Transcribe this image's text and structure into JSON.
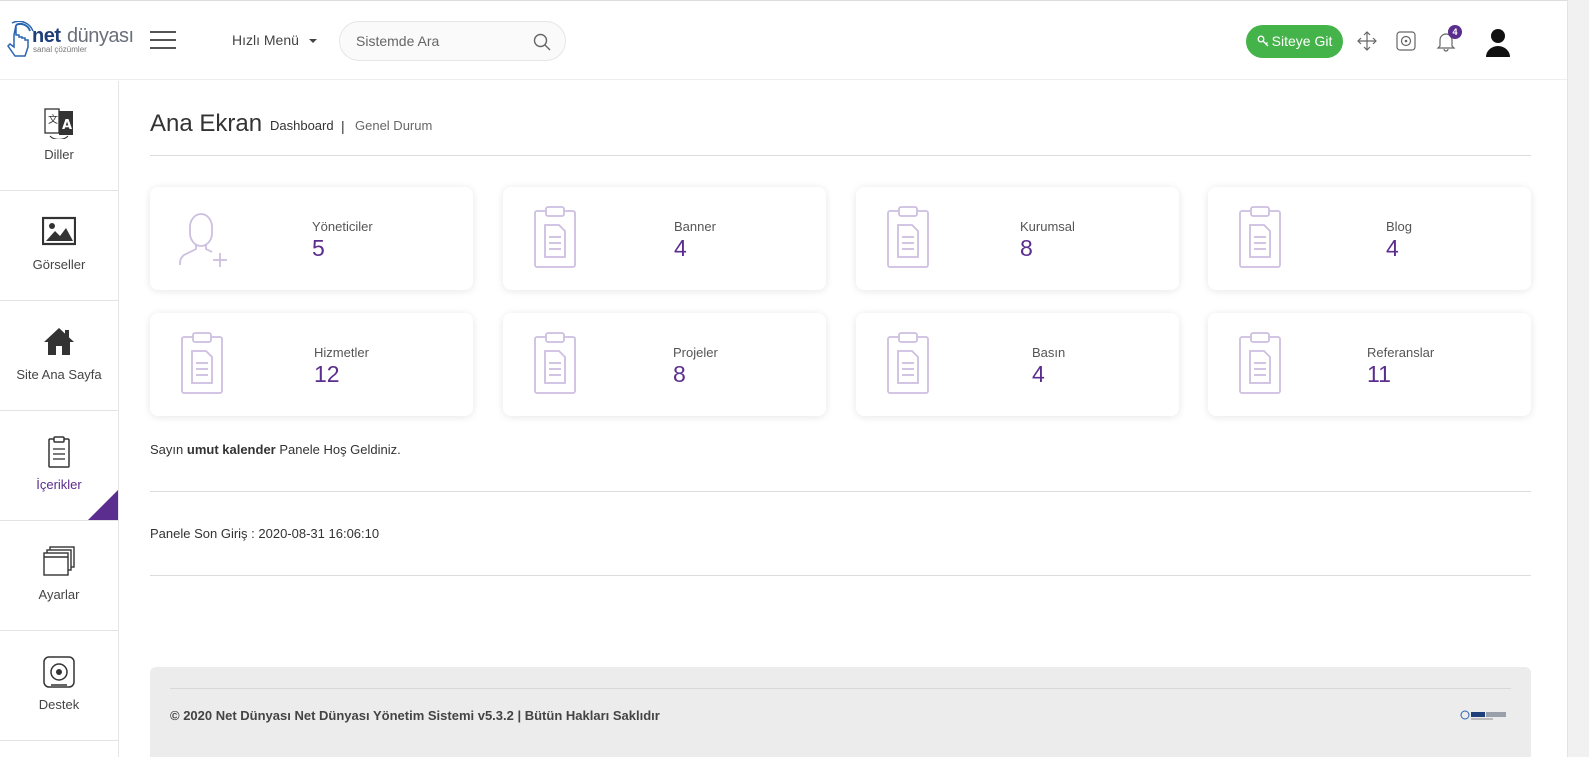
{
  "header": {
    "logo_net": "net",
    "logo_dunyasi": "dünyası",
    "logo_sub": "sanal çözümler",
    "quick_menu_label": "Hızlı Menü",
    "search_placeholder": "Sistemde Ara",
    "site_button_label": "Siteye Git",
    "notification_count": "4",
    "accent_color": "#5b2d8e",
    "button_color": "#44b34a"
  },
  "sidebar": {
    "items": [
      {
        "label": "Diller",
        "icon": "language-icon"
      },
      {
        "label": "Görseller",
        "icon": "image-icon"
      },
      {
        "label": "Site Ana Sayfa",
        "icon": "home-icon"
      },
      {
        "label": "İçerikler",
        "icon": "clipboard-icon",
        "active": true
      },
      {
        "label": "Ayarlar",
        "icon": "windows-icon"
      },
      {
        "label": "Destek",
        "icon": "support-icon"
      }
    ]
  },
  "page": {
    "title": "Ana Ekran",
    "breadcrumb_1": "Dashboard",
    "breadcrumb_sep": "|",
    "breadcrumb_2": "Genel Durum"
  },
  "cards": [
    {
      "label": "Yöneticiler",
      "value": "5",
      "icon": "add-user-icon"
    },
    {
      "label": "Banner",
      "value": "4",
      "icon": "clipboard-icon"
    },
    {
      "label": "Kurumsal",
      "value": "8",
      "icon": "clipboard-icon"
    },
    {
      "label": "Blog",
      "value": "4",
      "icon": "clipboard-icon"
    },
    {
      "label": "Hizmetler",
      "value": "12",
      "icon": "clipboard-icon"
    },
    {
      "label": "Projeler",
      "value": "8",
      "icon": "clipboard-icon"
    },
    {
      "label": "Basın",
      "value": "4",
      "icon": "clipboard-icon"
    },
    {
      "label": "Referanslar",
      "value": "11",
      "icon": "clipboard-icon"
    }
  ],
  "welcome": {
    "prefix": "Sayın",
    "user": "umut kalender",
    "suffix": "Panele Hoş Geldiniz."
  },
  "last_login": "Panele Son Giriş : 2020-08-31 16:06:10",
  "footer": {
    "text": "© 2020 Net Dünyası Net Dünyası Yönetim Sistemi v5.3.2 | Bütün Hakları Saklıdır"
  }
}
